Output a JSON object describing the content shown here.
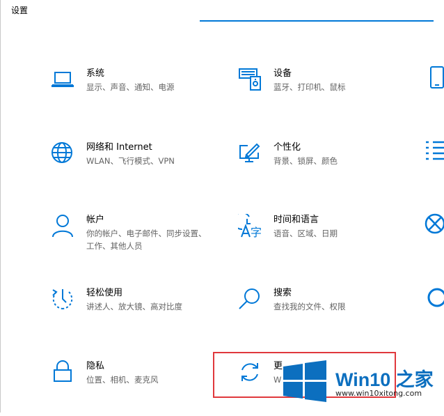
{
  "window": {
    "title": "设置"
  },
  "tiles": [
    {
      "title": "系统",
      "desc": "显示、声音、通知、电源",
      "icon": "laptop-icon"
    },
    {
      "title": "设备",
      "desc": "蓝牙、打印机、鼠标",
      "icon": "devices-icon"
    },
    {
      "title": "网络和 Internet",
      "desc": "WLAN、飞行模式、VPN",
      "icon": "globe-icon"
    },
    {
      "title": "个性化",
      "desc": "背景、锁屏、颜色",
      "icon": "personalization-icon"
    },
    {
      "title": "帐户",
      "desc": "你的帐户、电子邮件、同步设置、工作、其他人员",
      "icon": "person-icon"
    },
    {
      "title": "时间和语言",
      "desc": "语音、区域、日期",
      "icon": "time-language-icon"
    },
    {
      "title": "轻松使用",
      "desc": "讲述人、放大镜、高对比度",
      "icon": "ease-of-access-icon"
    },
    {
      "title": "搜索",
      "desc": "查找我的文件、权限",
      "icon": "search-icon"
    },
    {
      "title": "隐私",
      "desc": "位置、相机、麦克风",
      "icon": "lock-icon"
    },
    {
      "title": "更",
      "desc": "W",
      "icon": "sync-icon"
    }
  ],
  "watermark": {
    "brand": "Win10 之家",
    "url": "www.win10xitong.com"
  },
  "colors": {
    "accent": "#0078d7",
    "highlight_border": "#e0383c",
    "brand": "#0c6fbf"
  }
}
